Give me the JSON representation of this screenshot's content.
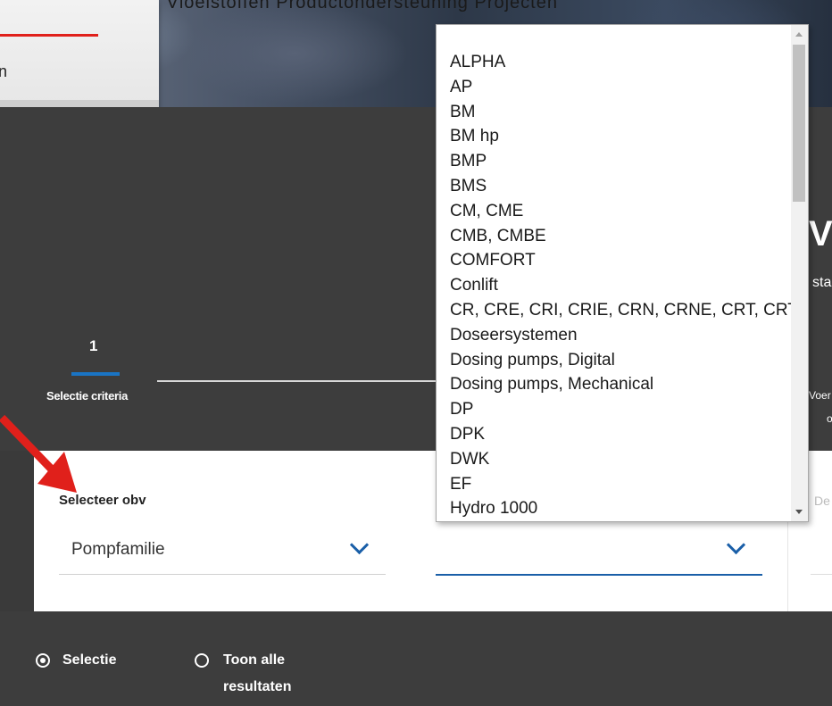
{
  "header": {
    "nav_fragment": "Categorieën    Vloeistoffen    Productondersteuning    Projecten",
    "left_fragment": "n"
  },
  "steps": {
    "active_number": "1",
    "active_label": "Selectie criteria",
    "right_fragment_big": "V",
    "right_fragment_sub": "sta",
    "right_fragment_voer": "Voer",
    "right_fragment_o": "o"
  },
  "form": {
    "select_by_label": "Selecteer obv",
    "select_by_value": "Pompfamilie",
    "family_value": "",
    "right_fragment": "De"
  },
  "dropdown": {
    "options": [
      "ALPHA",
      "AP",
      "BM",
      "BM hp",
      "BMP",
      "BMS",
      "CM, CME",
      "CMB, CMBE",
      "COMFORT",
      "Conlift",
      "CR, CRE, CRI, CRIE, CRN, CRNE, CRT, CRTE",
      "Doseersystemen",
      "Dosing pumps, Digital",
      "Dosing pumps, Mechanical",
      "DP",
      "DPK",
      "DWK",
      "EF",
      "Hydro 1000"
    ]
  },
  "results": {
    "option_selection": "Selectie",
    "option_all_line1": "Toon alle",
    "option_all_line2": "resultaten",
    "selected": "Selectie"
  },
  "colors": {
    "accent_blue": "#1a74c4",
    "brand_red": "#e0201b",
    "dark_bg": "#3d3d3d"
  }
}
